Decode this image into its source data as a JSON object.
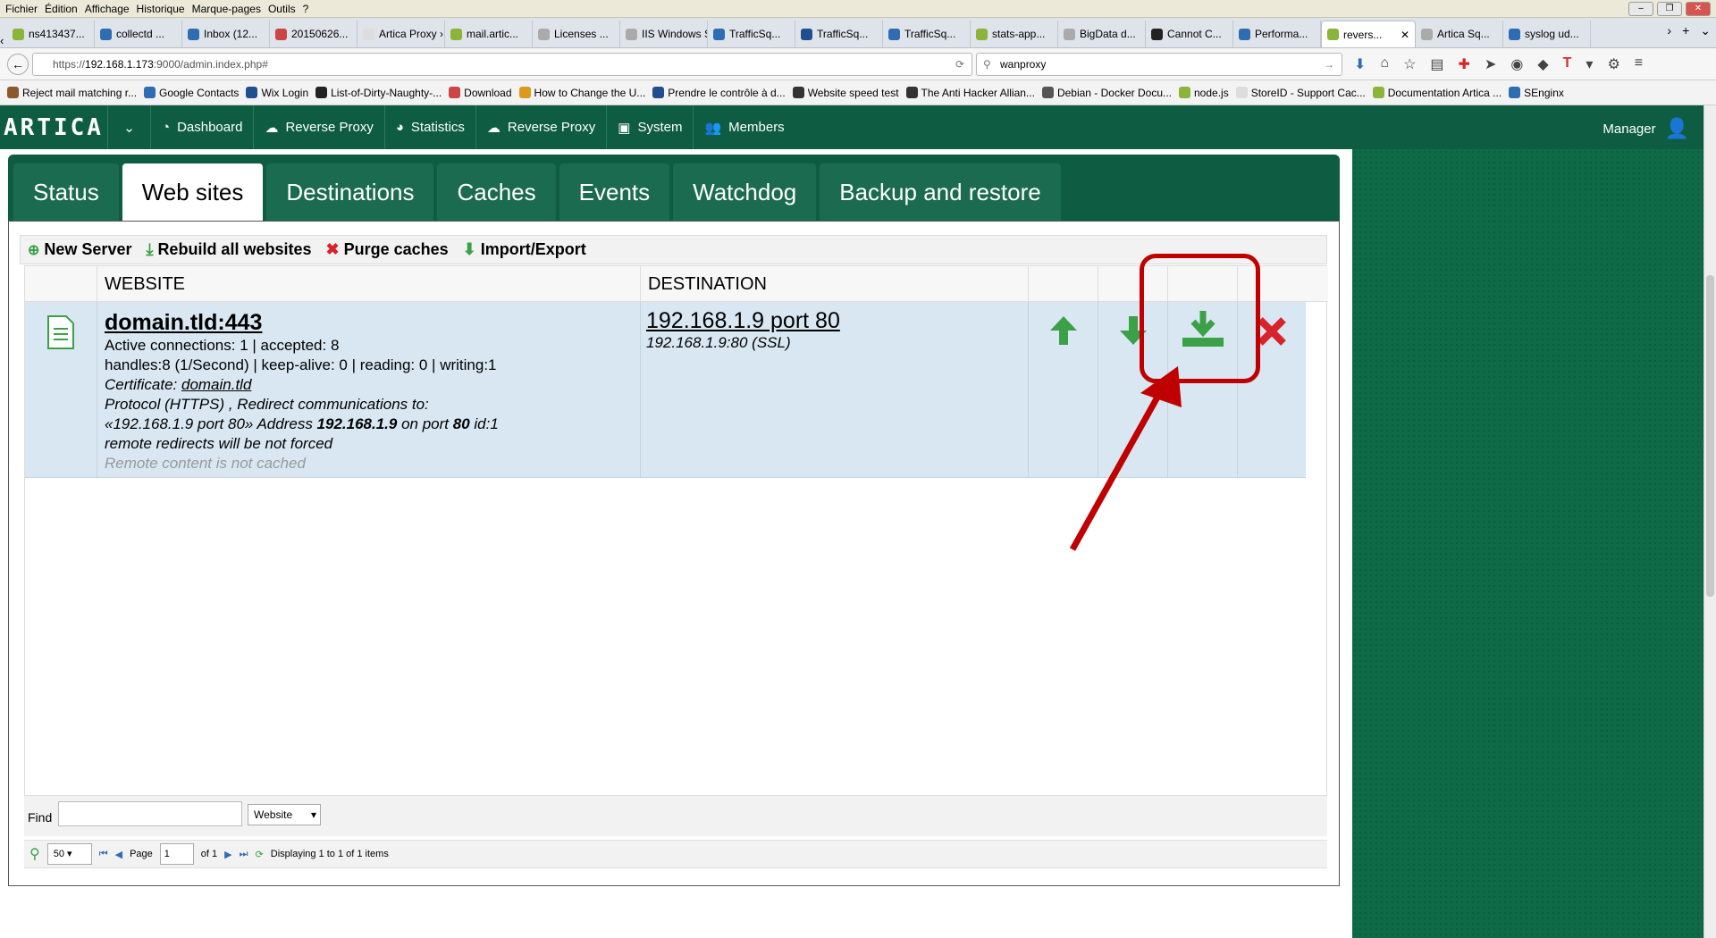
{
  "menubar": [
    "Fichier",
    "Édition",
    "Affichage",
    "Historique",
    "Marque-pages",
    "Outils",
    "?"
  ],
  "browser_tabs": [
    {
      "label": "ns413437...",
      "color": "#8bb43a"
    },
    {
      "label": "collectd ...",
      "color": "#2f6db3"
    },
    {
      "label": "Inbox (12...",
      "color": "#2f6db3"
    },
    {
      "label": "20150626...",
      "color": "#c44"
    },
    {
      "label": "Artica Proxy › ...",
      "color": "#ddd"
    },
    {
      "label": "mail.artic...",
      "color": "#8bb43a"
    },
    {
      "label": "Licenses ...",
      "color": "#aaa"
    },
    {
      "label": "IIS Windows S...",
      "color": "#aaa"
    },
    {
      "label": "TrafficSq...",
      "color": "#2f6db3"
    },
    {
      "label": "TrafficSq...",
      "color": "#1f4f8e"
    },
    {
      "label": "TrafficSq...",
      "color": "#2f6db3"
    },
    {
      "label": "stats-app...",
      "color": "#8bb43a"
    },
    {
      "label": "BigData d...",
      "color": "#aaa"
    },
    {
      "label": "Cannot C...",
      "color": "#222"
    },
    {
      "label": "Performa...",
      "color": "#2f6db3"
    },
    {
      "label": "revers...",
      "color": "#8bb43a",
      "active": true
    },
    {
      "label": "Artica Sq...",
      "color": "#aaa"
    },
    {
      "label": "syslog ud...",
      "color": "#2f6db3"
    }
  ],
  "url": {
    "prefix": "https://",
    "host": "192.168.1.173",
    "rest": ":9000/admin.index.php#"
  },
  "search_value": "wanproxy",
  "bookmarks": [
    "Reject mail matching r...",
    "Google Contacts",
    "Wix Login",
    "List-of-Dirty-Naughty-...",
    "Download",
    "How to Change the U...",
    "Prendre le contrôle à d...",
    "Website speed test",
    "The Anti Hacker Allian...",
    "Debian - Docker Docu...",
    "node.js",
    "StoreID - Support Cac...",
    "Documentation Artica ...",
    "SEnginx"
  ],
  "app": {
    "logo": "ARTICA",
    "menu": [
      "Dashboard",
      "Reverse Proxy",
      "Statistics",
      "Reverse Proxy",
      "System",
      "Members"
    ],
    "user": "Manager"
  },
  "main_tabs": [
    "Status",
    "Web sites",
    "Destinations",
    "Caches",
    "Events",
    "Watchdog",
    "Backup and restore"
  ],
  "toolbar": {
    "new_server": "New Server",
    "rebuild": "Rebuild all websites",
    "purge": "Purge caches",
    "import_export": "Import/Export"
  },
  "grid": {
    "headers": {
      "website": "WEBSITE",
      "destination": "DESTINATION"
    },
    "row": {
      "title": "domain.tld:443",
      "line1": "Active connections: 1 | accepted: 8",
      "line2": "handles:8 (1/Second) | keep-alive: 0 | reading: 0 | writing:1",
      "cert_label": "Certificate: ",
      "cert_value": "domain.tld",
      "line4": "Protocol (HTTPS) ,  Redirect communications to:",
      "line5a": "«192.168.1.9 port 80» Address ",
      "line5b": "192.168.1.9",
      "line5c": " on port ",
      "line5d": "80",
      "line5e": " id:1",
      "line6": "remote redirects will be not forced",
      "line7": "Remote content is not cached",
      "dest_title": "192.168.1.9 port 80",
      "dest_sub": "192.168.1.9:80 (SSL)"
    }
  },
  "find": {
    "label": "Find",
    "select": "Website"
  },
  "pager": {
    "page_size": "50",
    "page_label": "Page",
    "page_value": "1",
    "of_label": "of 1",
    "display": "Displaying 1 to 1 of 1 items"
  },
  "colors": {
    "brand_green": "#0e5d43",
    "action_green": "#3ba047",
    "delete_red": "#d9232a",
    "highlight_red": "#c00000"
  }
}
